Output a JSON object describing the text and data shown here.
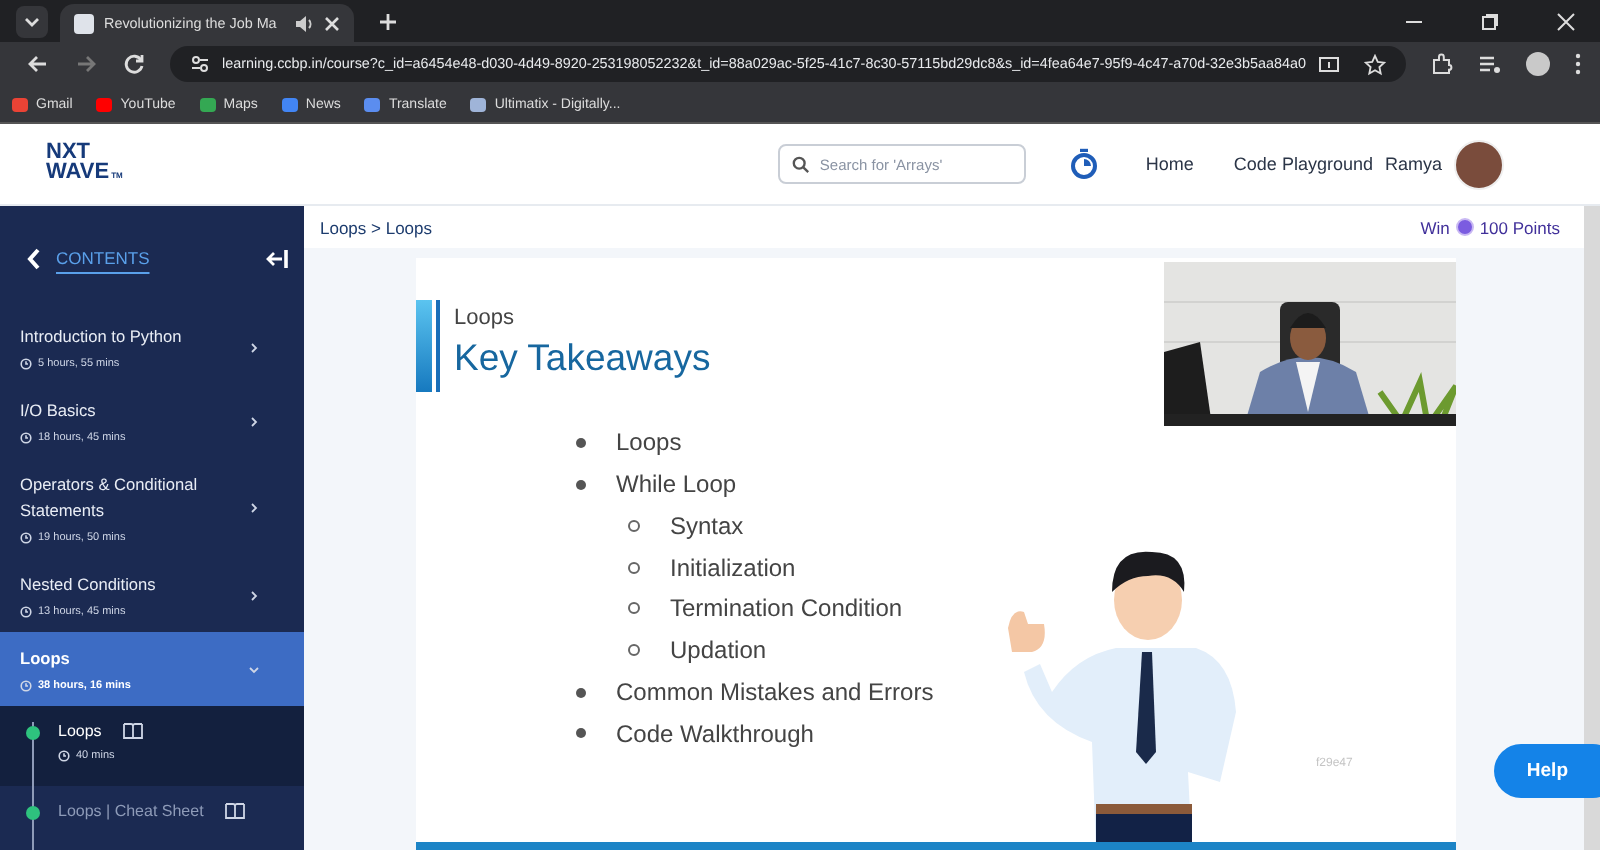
{
  "browser": {
    "tabs": [
      {
        "title": "Revolutionizing the Job Ma",
        "selected": true,
        "audio": true
      }
    ],
    "url": "learning.ccbp.in/course?c_id=a6454e48-d030-4d49-8920-253198052232&t_id=88a029ac-5f25-41c7-8c30-57115bd29dc8&s_id=4fea64e7-95f9-4c47-a70d-32e3b5aa84a0",
    "bookmarks": [
      {
        "label": "Gmail",
        "color": "#ea4335"
      },
      {
        "label": "YouTube",
        "color": "#ff0000"
      },
      {
        "label": "Maps",
        "color": "#34a853"
      },
      {
        "label": "News",
        "color": "#4285f4"
      },
      {
        "label": "Translate",
        "color": "#5b8def"
      },
      {
        "label": "Ultimatix - Digitally...",
        "color": "#9fb4d8"
      }
    ]
  },
  "header": {
    "logo": [
      "NXT",
      "WAVE",
      "TM"
    ],
    "search": {
      "placeholder": "Search for 'Arrays'"
    },
    "nav": [
      "Home",
      "Code Playground"
    ],
    "user": "Ramya"
  },
  "sidebar": {
    "title": "CONTENTS",
    "modules": [
      {
        "title": "Introduction to Python",
        "duration": "5 hours, 55 mins",
        "selected": false,
        "expanded": false
      },
      {
        "title": "I/O Basics",
        "duration": "18 hours, 45 mins",
        "selected": false,
        "expanded": false
      },
      {
        "title": "Operators & Conditional Statements",
        "duration": "19 hours, 50 mins",
        "selected": false,
        "expanded": false
      },
      {
        "title": "Nested Conditions",
        "duration": "13 hours, 45 mins",
        "selected": false,
        "expanded": false
      },
      {
        "title": "Loops",
        "duration": "38 hours, 16 mins",
        "selected": true,
        "expanded": true,
        "children": [
          {
            "title": "Loops",
            "duration": "40 mins",
            "completed": true,
            "selected": true
          },
          {
            "title": "Loops | Cheat Sheet",
            "completed": true,
            "selected": false
          }
        ]
      }
    ]
  },
  "breadcrumb": "Loops > Loops",
  "reward": {
    "prefix": "Win",
    "points": "100 Points"
  },
  "slide": {
    "subtitle": "Loops",
    "title": "Key Takeaways",
    "bullets": [
      {
        "text": "Loops"
      },
      {
        "text": "While Loop",
        "children": [
          {
            "text": "Syntax"
          },
          {
            "text": "Initialization"
          },
          {
            "text": "Termination Condition"
          },
          {
            "text": "Updation"
          }
        ]
      },
      {
        "text": "Common Mistakes and Errors"
      },
      {
        "text": "Code Walkthrough"
      }
    ],
    "code": "f29e47"
  },
  "help": "Help"
}
